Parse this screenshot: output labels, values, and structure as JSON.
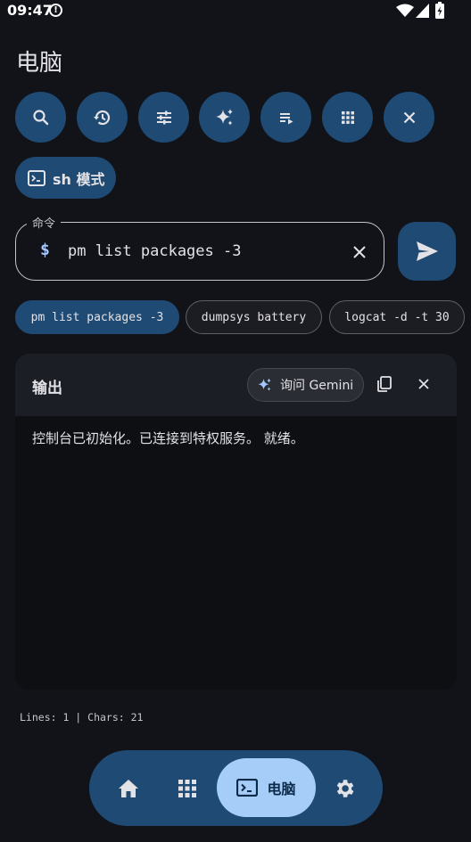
{
  "status_bar": {
    "time": "09:47"
  },
  "page_title": "电脑",
  "toolbar": {
    "buttons": [
      "search-icon",
      "history-icon",
      "tune-icon",
      "sparkle-icon",
      "playlist-icon",
      "apps-grid-icon",
      "close-icon"
    ]
  },
  "mode_chip": {
    "label": "sh 模式"
  },
  "command": {
    "legend": "命令",
    "prompt": "$",
    "value": "pm list packages -3"
  },
  "suggestions": [
    {
      "label": "pm list packages -3",
      "active": true
    },
    {
      "label": "dumpsys battery",
      "active": false
    },
    {
      "label": "logcat -d -t 30",
      "active": false
    }
  ],
  "output": {
    "title": "输出",
    "ask_button": "询问 Gemini",
    "text": "控制台已初始化。已连接到特权服务。 就绪。"
  },
  "stats": "Lines: 1 | Chars: 21",
  "bottom_nav": {
    "active_label": "电脑"
  },
  "colors": {
    "background": "#111318",
    "accent_container": "#1f4a73",
    "nav_active": "#a6cdf7",
    "prompt": "#a6c8ff"
  }
}
